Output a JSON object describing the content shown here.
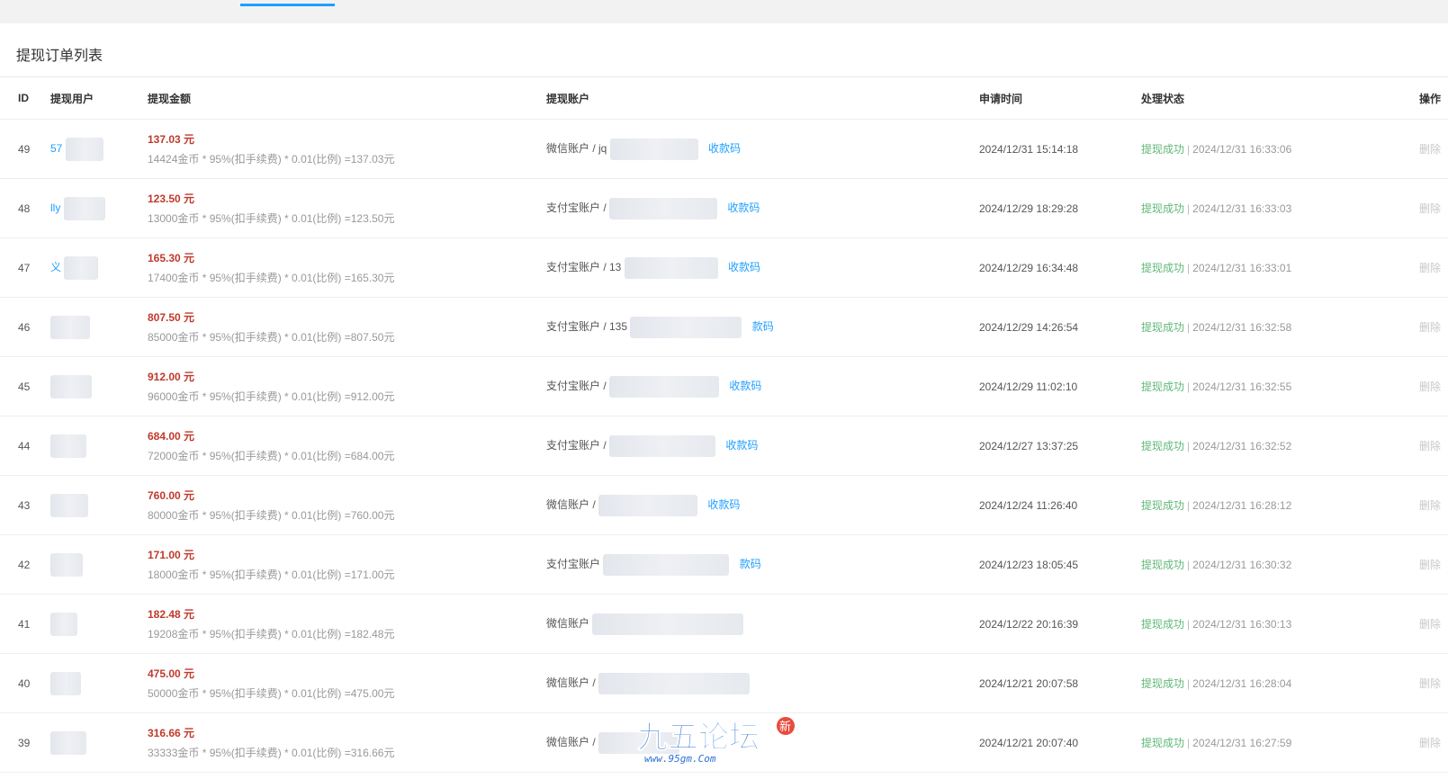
{
  "panel": {
    "title": "提现订单列表"
  },
  "columns": {
    "id": "ID",
    "user": "提现用户",
    "amount": "提现金额",
    "account": "提现账户",
    "apply_time": "申请时间",
    "status": "处理状态",
    "op": "操作"
  },
  "rows": [
    {
      "id": "49",
      "user": "57",
      "amount": "137.03 元",
      "formula": "14424金币 * 95%(扣手续费) * 0.01(比例) =137.03元",
      "account": "微信账户 / jq",
      "qr": "收款码",
      "apply_time": "2024/12/31 15:14:18",
      "status": "提现成功",
      "status_time": "2024/12/31 16:33:06",
      "del": "删除"
    },
    {
      "id": "48",
      "user": "lly",
      "amount": "123.50 元",
      "formula": "13000金币 * 95%(扣手续费) * 0.01(比例) =123.50元",
      "account": "支付宝账户 /",
      "qr": "收款码",
      "apply_time": "2024/12/29 18:29:28",
      "status": "提现成功",
      "status_time": "2024/12/31 16:33:03",
      "del": "删除"
    },
    {
      "id": "47",
      "user": "义",
      "amount": "165.30 元",
      "formula": "17400金币 * 95%(扣手续费) * 0.01(比例) =165.30元",
      "account": "支付宝账户 / 13",
      "qr": "收款码",
      "apply_time": "2024/12/29 16:34:48",
      "status": "提现成功",
      "status_time": "2024/12/31 16:33:01",
      "del": "删除"
    },
    {
      "id": "46",
      "user": "",
      "amount": "807.50 元",
      "formula": "85000金币 * 95%(扣手续费) * 0.01(比例) =807.50元",
      "account": "支付宝账户 / 135",
      "qr": "款码",
      "apply_time": "2024/12/29 14:26:54",
      "status": "提现成功",
      "status_time": "2024/12/31 16:32:58",
      "del": "删除"
    },
    {
      "id": "45",
      "user": "",
      "amount": "912.00 元",
      "formula": "96000金币 * 95%(扣手续费) * 0.01(比例) =912.00元",
      "account": "支付宝账户 /",
      "qr": "收款码",
      "apply_time": "2024/12/29 11:02:10",
      "status": "提现成功",
      "status_time": "2024/12/31 16:32:55",
      "del": "删除"
    },
    {
      "id": "44",
      "user": "",
      "amount": "684.00 元",
      "formula": "72000金币 * 95%(扣手续费) * 0.01(比例) =684.00元",
      "account": "支付宝账户 /",
      "qr": "收款码",
      "apply_time": "2024/12/27 13:37:25",
      "status": "提现成功",
      "status_time": "2024/12/31 16:32:52",
      "del": "删除"
    },
    {
      "id": "43",
      "user": "",
      "amount": "760.00 元",
      "formula": "80000金币 * 95%(扣手续费) * 0.01(比例) =760.00元",
      "account": "微信账户 /",
      "qr": "收款码",
      "apply_time": "2024/12/24 11:26:40",
      "status": "提现成功",
      "status_time": "2024/12/31 16:28:12",
      "del": "删除"
    },
    {
      "id": "42",
      "user": "",
      "amount": "171.00 元",
      "formula": "18000金币 * 95%(扣手续费) * 0.01(比例) =171.00元",
      "account": "支付宝账户",
      "qr": "款码",
      "apply_time": "2024/12/23 18:05:45",
      "status": "提现成功",
      "status_time": "2024/12/31 16:30:32",
      "del": "删除"
    },
    {
      "id": "41",
      "user": "",
      "amount": "182.48 元",
      "formula": "19208金币 * 95%(扣手续费) * 0.01(比例) =182.48元",
      "account": "微信账户",
      "qr": "",
      "apply_time": "2024/12/22 20:16:39",
      "status": "提现成功",
      "status_time": "2024/12/31 16:30:13",
      "del": "删除"
    },
    {
      "id": "40",
      "user": "",
      "amount": "475.00 元",
      "formula": "50000金币 * 95%(扣手续费) * 0.01(比例) =475.00元",
      "account": "微信账户 /",
      "qr": "",
      "apply_time": "2024/12/21 20:07:58",
      "status": "提现成功",
      "status_time": "2024/12/31 16:28:04",
      "del": "删除"
    },
    {
      "id": "39",
      "user": "",
      "amount": "316.66 元",
      "formula": "33333金币 * 95%(扣手续费) * 0.01(比例) =316.66元",
      "account": "微信账户 /",
      "qr": "",
      "apply_time": "2024/12/21 20:07:40",
      "status": "提现成功",
      "status_time": "2024/12/31 16:27:59",
      "del": "删除"
    }
  ],
  "watermark": {
    "text": "九五论坛",
    "sub": "www.95gm.Com",
    "badge": "新"
  }
}
